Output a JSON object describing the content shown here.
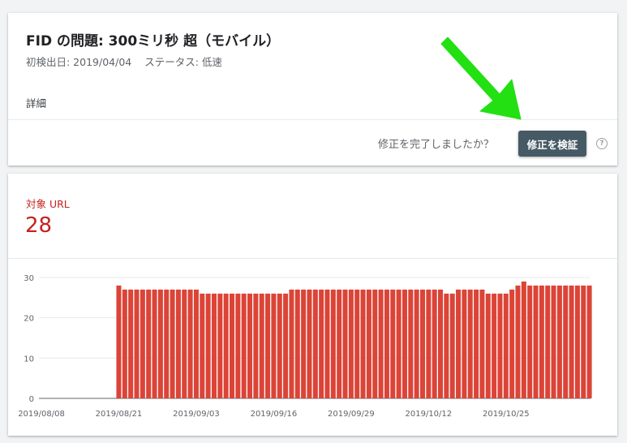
{
  "issue": {
    "title": "FID の問題: 300ミリ秒 超（モバイル）",
    "first_detected_label": "初検出日: 2019/04/04",
    "status_label": "ステータス: 低速",
    "details_tab": "詳細",
    "fix_question": "修正を完了しましたか？",
    "validate_button": "修正を検証",
    "help_icon": "help-circle-icon",
    "help_glyph": "?"
  },
  "metric": {
    "label": "対象 URL",
    "value": "28",
    "color": "#c5221f"
  },
  "annotation": {
    "arrow_color": "#22e012"
  },
  "chart_data": {
    "type": "bar",
    "color": "#db4437",
    "x_start_date": "2019/08/08",
    "x_ticks": [
      "2019/08/08",
      "2019/08/21",
      "2019/09/03",
      "2019/09/16",
      "2019/09/29",
      "2019/10/12",
      "2019/10/25"
    ],
    "y_ticks": [
      "0",
      "10",
      "20",
      "30"
    ],
    "ylim": [
      0,
      30
    ],
    "grid": true,
    "values": [
      0,
      0,
      0,
      0,
      0,
      0,
      0,
      0,
      0,
      0,
      0,
      0,
      0,
      28,
      27,
      27,
      27,
      27,
      27,
      27,
      27,
      27,
      27,
      27,
      27,
      27,
      27,
      26,
      26,
      26,
      26,
      26,
      26,
      26,
      26,
      26,
      26,
      26,
      26,
      26,
      26,
      26,
      27,
      27,
      27,
      27,
      27,
      27,
      27,
      27,
      27,
      27,
      27,
      27,
      27,
      27,
      27,
      27,
      27,
      27,
      27,
      27,
      27,
      27,
      27,
      27,
      27,
      27,
      26,
      26,
      27,
      27,
      27,
      27,
      27,
      26,
      26,
      26,
      26,
      27,
      28,
      29,
      28,
      28,
      28,
      28,
      28,
      28,
      28,
      28,
      28,
      28,
      28
    ]
  }
}
